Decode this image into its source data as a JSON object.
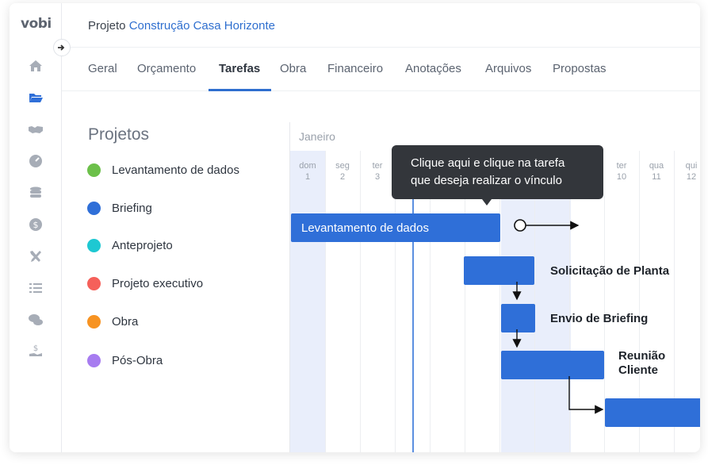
{
  "app": {
    "logo": "vobi"
  },
  "header": {
    "prefix": "Projeto",
    "project_name": "Construção Casa Horizonte"
  },
  "tabs": [
    {
      "label": "Geral"
    },
    {
      "label": "Orçamento"
    },
    {
      "label": "Tarefas",
      "active": true
    },
    {
      "label": "Obra"
    },
    {
      "label": "Financeiro"
    },
    {
      "label": "Anotações"
    },
    {
      "label": "Arquivos"
    },
    {
      "label": "Propostas"
    }
  ],
  "sidebar": {
    "icons": [
      "home-icon",
      "folder-icon",
      "handshake-icon",
      "gauge-icon",
      "coins-icon",
      "dollar-icon",
      "tools-icon",
      "list-icon",
      "chat-dollar-icon",
      "hand-dollar-icon"
    ]
  },
  "projects": {
    "title": "Projetos",
    "items": [
      {
        "label": "Levantamento de dados",
        "color": "#6cc04a"
      },
      {
        "label": "Briefing",
        "color": "#2f6fd8"
      },
      {
        "label": "Anteprojeto",
        "color": "#1ec8d2"
      },
      {
        "label": "Projeto executivo",
        "color": "#f5605a"
      },
      {
        "label": "Obra",
        "color": "#f79322"
      },
      {
        "label": "Pós-Obra",
        "color": "#a77cf0"
      }
    ]
  },
  "gantt": {
    "month": "Janeiro",
    "days": [
      {
        "dow": "dom",
        "day": "1"
      },
      {
        "dow": "seg",
        "day": "2"
      },
      {
        "dow": "ter",
        "day": "3"
      },
      {
        "dow": "",
        "day": ""
      },
      {
        "dow": "",
        "day": ""
      },
      {
        "dow": "",
        "day": ""
      },
      {
        "dow": "",
        "day": ""
      },
      {
        "dow": "",
        "day": ""
      },
      {
        "dow": "",
        "day": ""
      },
      {
        "dow": "ter",
        "day": "10"
      },
      {
        "dow": "qua",
        "day": "11"
      },
      {
        "dow": "qui",
        "day": "12"
      }
    ],
    "tasks": [
      {
        "label": "Levantamento de dados"
      },
      {
        "label": "Solicitação de Planta"
      },
      {
        "label": "Envio de Briefing"
      },
      {
        "label": "Reunião",
        "label2": "Cliente"
      },
      {
        "label": ""
      }
    ],
    "tooltip": {
      "line1": "Clique aqui e clique na tarefa",
      "line2": "que deseja realizar o vínculo"
    }
  }
}
